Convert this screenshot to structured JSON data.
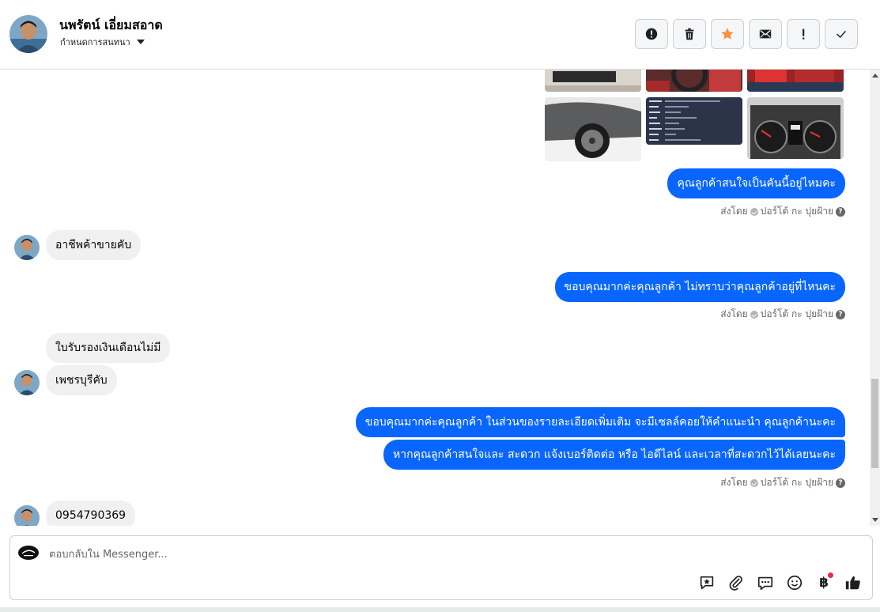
{
  "header": {
    "contact_name": "นพรัตน์ เอี่ยมสอาด",
    "assign_label": "กำหนดการสนทนา"
  },
  "actions": [
    {
      "name": "spam-button",
      "icon": "alert-circle-icon"
    },
    {
      "name": "delete-button",
      "icon": "trash-icon"
    },
    {
      "name": "star-button",
      "icon": "star-icon",
      "color": "#f7923a"
    },
    {
      "name": "mark-unread-button",
      "icon": "envelope-icon"
    },
    {
      "name": "follow-up-button",
      "icon": "exclamation-icon"
    },
    {
      "name": "done-button",
      "icon": "check-icon"
    }
  ],
  "messages": {
    "m1": "คุณลูกค้าสนใจเป็นคันนี้อยู่ไหมคะ",
    "sent1": "ส่งโดย",
    "sent1_name": "ปอร์โต้ กะ ปุยฝ้าย",
    "m2": "อาชีพค้าขายคับ",
    "m3": "ขอบคุณมากค่ะคุณลูกค้า  ไม่ทราบว่าคุณลูกค้าอยู่ที่ไหนคะ",
    "sent2": "ส่งโดย",
    "sent2_name": "ปอร์โต้ กะ ปุยฝ้าย",
    "m4": "ใบรับรองเงินเดือนไม่มี",
    "m5": "เพชรบุรีคับ",
    "m6": "ขอบคุณมากค่ะคุณลูกค้า  ในส่วนของรายละเอียดเพิ่มเติม จะมีเซลล์คอยให้คำแนะนำ คุณลูกค้านะคะ",
    "m7": "หากคุณลูกค้าสนใจและ สะดวก แจ้งเบอร์ติดต่อ หรือ ไอดีไลน์ และเวลาที่สะดวกไว้ได้เลยนะคะ",
    "sent3": "ส่งโดย",
    "sent3_name": "ปอร์โต้ กะ ปุยฝ้าย",
    "m8": "0954790369"
  },
  "composer": {
    "placeholder": "ตอบกลับใน Messenger...",
    "baht_symbol": "฿"
  },
  "colors": {
    "outgoing_bubble": "#0866ff",
    "incoming_bubble": "#f0f0f0",
    "notification_dot": "#f02849"
  }
}
